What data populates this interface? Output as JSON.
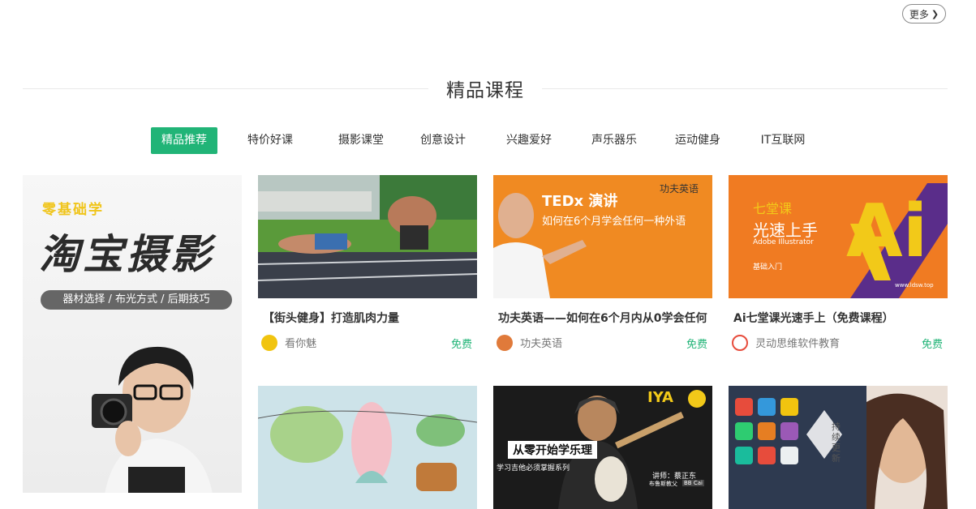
{
  "header": {
    "more_label": "更多"
  },
  "section": {
    "title": "精品课程"
  },
  "tabs": [
    {
      "label": "精品推荐",
      "active": true
    },
    {
      "label": "特价好课"
    },
    {
      "label": "摄影课堂"
    },
    {
      "label": "创意设计"
    },
    {
      "label": "兴趣爱好"
    },
    {
      "label": "声乐器乐"
    },
    {
      "label": "运动健身"
    },
    {
      "label": "IT互联网"
    }
  ],
  "promo": {
    "subtitle": "零基础学",
    "title": "淘宝摄影",
    "tags": "器材选择 / 布光方式 / 后期技巧"
  },
  "courses": [
    {
      "title": "【街头健身】打造肌肉力量",
      "author": "看你魅",
      "price": "免费",
      "thumb_text": []
    },
    {
      "title": "功夫英语——如何在6个月内从0学会任何",
      "author": "功夫英语",
      "price": "免费",
      "thumb_text": [
        "TEDx 演讲",
        "如何在6个月学会任何一种外语",
        "功夫英语"
      ]
    },
    {
      "title": "Ai七堂课光速手上（免费课程）",
      "author": "灵动思维软件教育",
      "price": "免费",
      "thumb_text": [
        "七堂课",
        "光速上手",
        "Adobe Illustrator",
        "基础入门",
        "www.ldsw.top"
      ]
    },
    {
      "title": "",
      "author": "",
      "price": "",
      "thumb_text": []
    },
    {
      "title": "",
      "author": "",
      "price": "",
      "thumb_text": [
        "IYA",
        "从零开始学乐理",
        "学习吉他必须掌握系列",
        "讲师：蔡正东",
        "布鲁斯教父",
        "BB Cai"
      ]
    },
    {
      "title": "",
      "author": "",
      "price": "",
      "thumb_text": [
        "持续更新"
      ]
    }
  ],
  "colors": {
    "accent": "#21b477",
    "text": "#333333",
    "muted": "#777777"
  }
}
